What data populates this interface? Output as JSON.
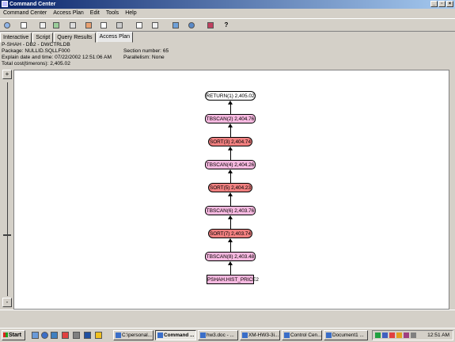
{
  "window": {
    "title": "Command Center"
  },
  "menu": [
    "Command Center",
    "Access Plan",
    "Edit",
    "Tools",
    "Help"
  ],
  "toolbar": {
    "icons": [
      "open-plan-icon",
      "script-icon",
      "history-icon",
      "query-icon",
      "results-icon",
      "copy-icon",
      "paste-icon",
      "explain-icon",
      "options-icon",
      "list-icon",
      "tree-icon",
      "task-icon",
      "help-icon"
    ],
    "help_label": "?"
  },
  "tabs": [
    "Interactive",
    "Script",
    "Query Results",
    "Access Plan"
  ],
  "active_tab": "Access Plan",
  "info": {
    "line1": "P-SHAH - DB2 - DWCTRLDB",
    "line2": "Package: NULLID.SQLLF000",
    "line3": "Explain date and time: 07/22/2002 12:51:06 AM",
    "line4": "Total cost(timerons): 2,405.02",
    "section": "Section number: 65",
    "parallelism": "Parallelism: None"
  },
  "zoom": {
    "in": "+",
    "out": "-"
  },
  "plan_nodes": [
    {
      "label": "RETURN(1) 2,405.02",
      "kind": "ret"
    },
    {
      "label": "TBSCAN(2) 2,404.76",
      "kind": "tbscan"
    },
    {
      "label": "SORT(3) 2,404.74",
      "kind": "sort"
    },
    {
      "label": "TBSCAN(4) 2,404.26",
      "kind": "tbscan"
    },
    {
      "label": "SORT(5) 2,404.23",
      "kind": "sort"
    },
    {
      "label": "TBSCAN(6) 2,403.76",
      "kind": "tbscan"
    },
    {
      "label": "SORT(7) 2,403.74",
      "kind": "sort"
    },
    {
      "label": "TBSCAN(8) 2,403.48",
      "kind": "tbscan"
    },
    {
      "label": "PSHAH.HIST_PRICE2",
      "kind": "table"
    }
  ],
  "colors": {
    "tbscan": "#f7b9e0",
    "sort": "#f08080",
    "return": "#ffffff",
    "title_start": "#0a246a",
    "title_end": "#a6caf0"
  },
  "taskbar": {
    "start": "Start",
    "tasks": [
      {
        "label": "C:\\personal...",
        "active": false
      },
      {
        "label": "Command ...",
        "active": true
      },
      {
        "label": "hw3.doc - ...",
        "active": false
      },
      {
        "label": "XM-HW3-3i...",
        "active": false
      },
      {
        "label": "Control Cen...",
        "active": false
      },
      {
        "label": "Document1 ...",
        "active": false
      }
    ],
    "clock": "12:51 AM"
  }
}
